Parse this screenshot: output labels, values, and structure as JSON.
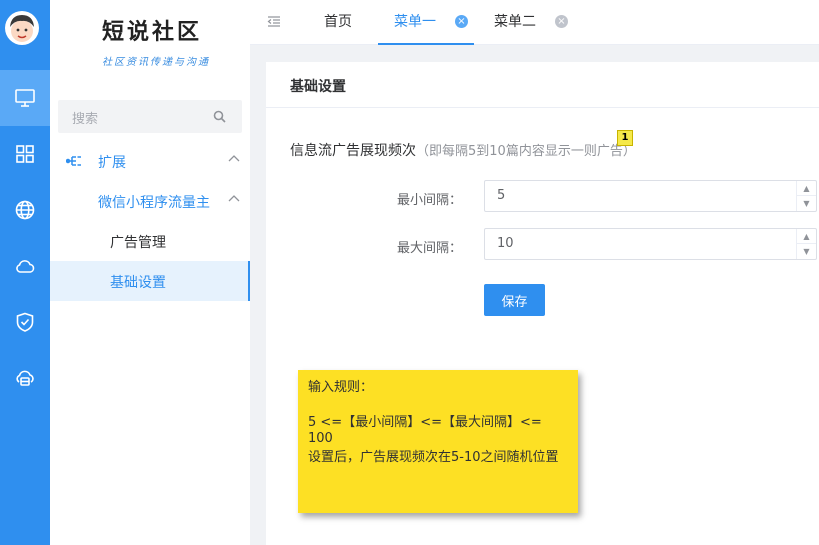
{
  "app": {
    "logo_title": "短说社区",
    "logo_slogan": "社区资讯传递与沟通"
  },
  "colors": {
    "accent": "#2f8fef",
    "rail_active": "#5aa9f6",
    "note_yellow": "#fde024"
  },
  "rail": {
    "items": [
      {
        "icon": "monitor-icon",
        "active": true
      },
      {
        "icon": "grid-icon"
      },
      {
        "icon": "globe-icon"
      },
      {
        "icon": "cloud-icon"
      },
      {
        "icon": "shield-check-icon"
      },
      {
        "icon": "cloud-database-icon"
      }
    ]
  },
  "sidebar": {
    "search_placeholder": "搜索",
    "menu": {
      "group_label": "扩展",
      "submenu_label": "微信小程序流量主",
      "items": [
        {
          "label": "广告管理"
        },
        {
          "label": "基础设置",
          "active": true
        }
      ]
    }
  },
  "tabs": [
    {
      "label": "首页"
    },
    {
      "label": "菜单一",
      "active": true,
      "closable": true
    },
    {
      "label": "菜单二",
      "closable": true
    }
  ],
  "card": {
    "title": "基础设置",
    "section_label": "信息流广告展现频次",
    "section_hint": "（即每隔5到10篇内容显示一则广告）",
    "badge": "1",
    "min_label": "最小间隔：",
    "min_value": "5",
    "max_label": "最大间隔：",
    "max_value": "10",
    "save_label": "保存"
  },
  "note": {
    "line1": "输入规则：",
    "line2": "5 <=【最小间隔】<=【最大间隔】<= 100",
    "line3": "设置后，广告展现频次在5-10之间随机位置"
  }
}
